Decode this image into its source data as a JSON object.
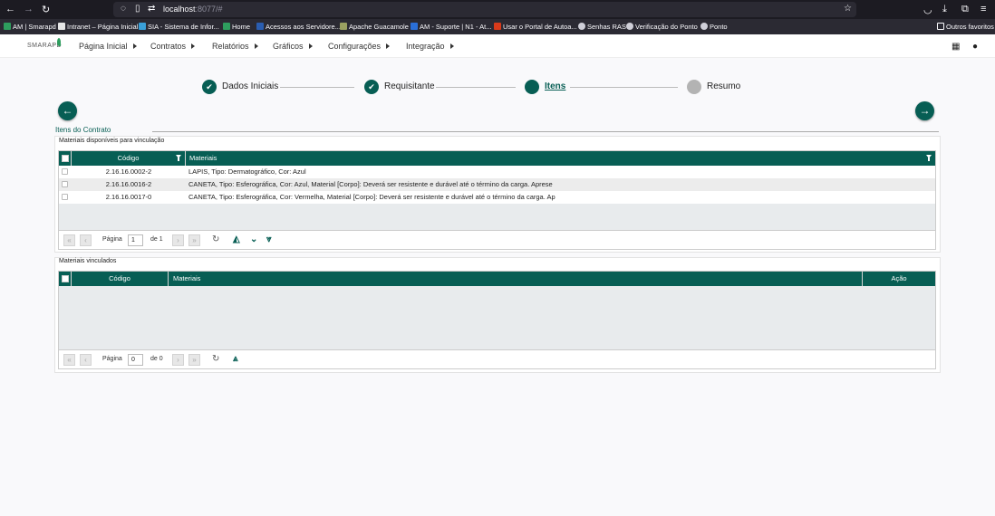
{
  "browser": {
    "url_host": "localhost",
    "url_rest": ":8077/#",
    "bookmarks": [
      {
        "label": "AM | Smarapd",
        "color": "#2e9e5e"
      },
      {
        "label": "Intranet – Página Inicial",
        "color": "#e6e6e6"
      },
      {
        "label": "SIA - Sistema de Infor...",
        "color": "#3aa0d8"
      },
      {
        "label": "Home",
        "color": "#2e9e5e"
      },
      {
        "label": "Acessos aos Servidore...",
        "color": "#2a5db0"
      },
      {
        "label": "Apache Guacamole",
        "color": "#9aa060"
      },
      {
        "label": "AM - Suporte | N1 - At...",
        "color": "#2a6fd8"
      },
      {
        "label": "Usar o Portal de Autoa...",
        "color": "#d83a1a"
      },
      {
        "label": "Senhas RAS",
        "color": "#cfcfd8"
      },
      {
        "label": "Verificação do Ponto",
        "color": "#cfcfd8"
      },
      {
        "label": "Ponto",
        "color": "#cfcfd8"
      }
    ],
    "other_bookmarks": "Outros favoritos"
  },
  "app": {
    "logo": "SMARAPD",
    "menu": [
      "Página Inicial",
      "Contratos",
      "Relatórios",
      "Gráficos",
      "Configurações",
      "Integração"
    ]
  },
  "stepper": {
    "steps": [
      {
        "label": "Dados Iniciais",
        "state": "done"
      },
      {
        "label": "Requisitante",
        "state": "done"
      },
      {
        "label": "Itens",
        "state": "active"
      },
      {
        "label": "Resumo",
        "state": "pending"
      }
    ]
  },
  "section": {
    "title": "Itens do Contrato"
  },
  "available": {
    "legend": "Materiais disponíveis para vinculação",
    "columns": {
      "code": "Código",
      "materials": "Materiais"
    },
    "rows": [
      {
        "code": "2.16.16.0002-2",
        "material": "LAPIS, Tipo: Dermatográfico, Cor: Azul"
      },
      {
        "code": "2.16.16.0016-2",
        "material": "CANETA, Tipo: Esferográfica, Cor: Azul, Material [Corpo]: Deverá ser resistente e durável até o término da carga. Aprese"
      },
      {
        "code": "2.16.16.0017-0",
        "material": "CANETA, Tipo: Esferográfica, Cor: Vermelha, Material [Corpo]: Deverá ser resistente e durável até o término da carga. Ap"
      }
    ],
    "pager": {
      "page_label": "Página",
      "page": "1",
      "of_label": "de 1"
    }
  },
  "linked": {
    "legend": "Materiais vinculados",
    "columns": {
      "code": "Código",
      "materials": "Materiais",
      "action": "Ação"
    },
    "pager": {
      "page_label": "Página",
      "page": "0",
      "of_label": "de 0"
    }
  },
  "colors": {
    "primary": "#075e54",
    "pending": "#b3b3b3"
  }
}
